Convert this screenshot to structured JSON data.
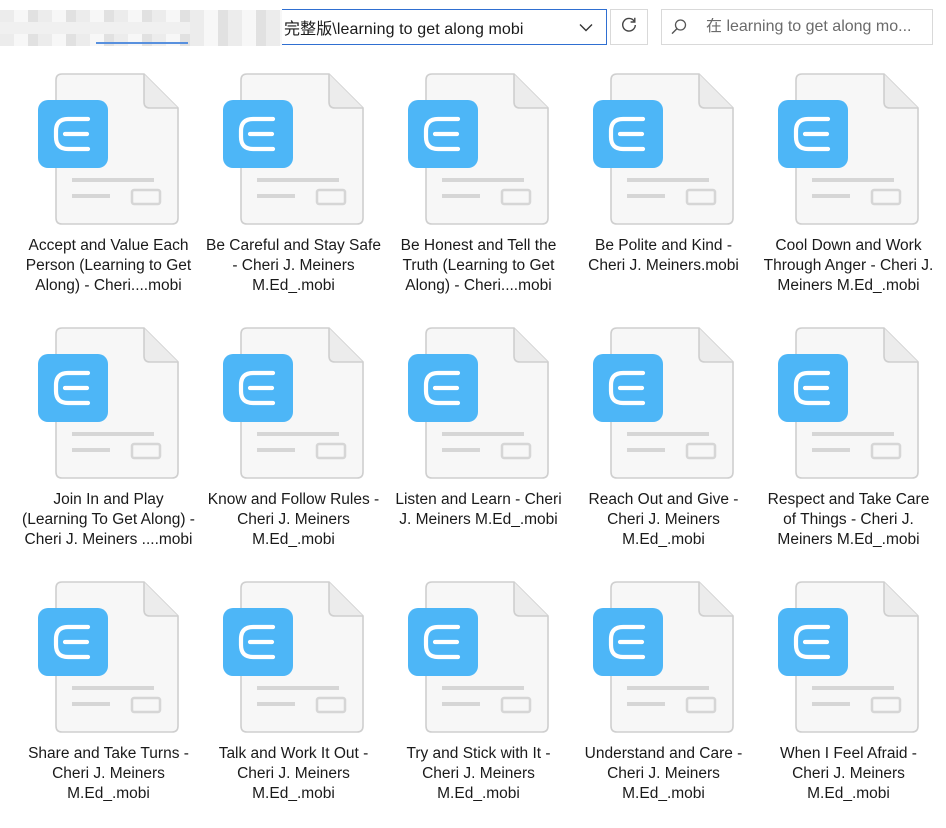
{
  "address": {
    "path": "完整版\\learning to get along mobi"
  },
  "search": {
    "placeholder": "在 learning to get along mo..."
  },
  "icons": {
    "dropdown": "chevron-down-icon",
    "refresh": "refresh-icon",
    "search": "search-icon",
    "file": "mobi-file-icon"
  },
  "colors": {
    "accent": "#2f6fd1",
    "file_badge": "#4db6f7",
    "file_page": "#f7f7f7"
  },
  "files": [
    {
      "name": "Accept and Value Each Person (Learning to Get Along) - Cheri....mobi"
    },
    {
      "name": "Be Careful and Stay Safe - Cheri J. Meiners M.Ed_.mobi"
    },
    {
      "name": "Be Honest and Tell the Truth (Learning to Get Along) - Cheri....mobi"
    },
    {
      "name": "Be Polite and Kind - Cheri J. Meiners.mobi"
    },
    {
      "name": "Cool Down and Work Through Anger - Cheri J. Meiners M.Ed_.mobi"
    },
    {
      "name": "Join In and Play (Learning To Get Along) - Cheri J. Meiners ....mobi"
    },
    {
      "name": "Know and Follow Rules - Cheri J. Meiners M.Ed_.mobi"
    },
    {
      "name": "Listen and Learn - Cheri J. Meiners M.Ed_.mobi"
    },
    {
      "name": "Reach Out and Give - Cheri J. Meiners M.Ed_.mobi"
    },
    {
      "name": "Respect and Take Care of Things - Cheri J. Meiners M.Ed_.mobi"
    },
    {
      "name": "Share and Take Turns - Cheri J. Meiners M.Ed_.mobi"
    },
    {
      "name": "Talk and Work It Out - Cheri J. Meiners M.Ed_.mobi"
    },
    {
      "name": "Try and Stick with It - Cheri J. Meiners M.Ed_.mobi"
    },
    {
      "name": "Understand and Care - Cheri J. Meiners M.Ed_.mobi"
    },
    {
      "name": "When I Feel Afraid - Cheri J. Meiners M.Ed_.mobi"
    }
  ]
}
